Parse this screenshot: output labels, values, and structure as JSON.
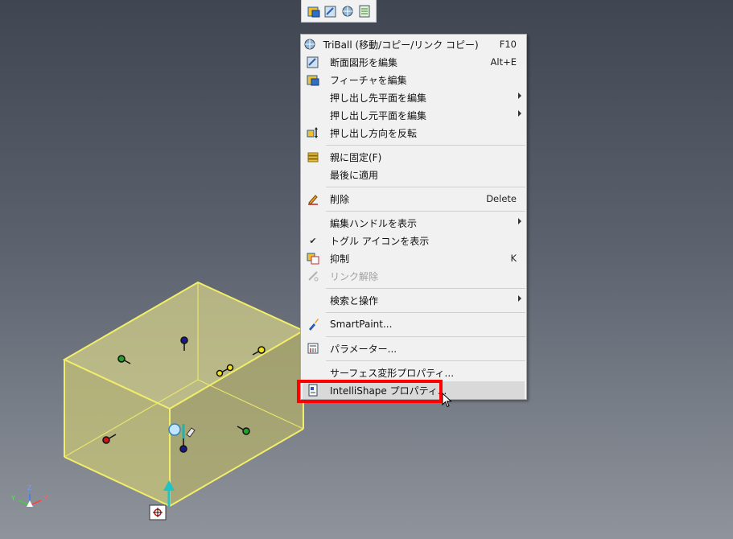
{
  "toolbar": {
    "icons": [
      "edit-feature-icon",
      "edit-section-icon",
      "triball-icon",
      "parameters-icon"
    ]
  },
  "menu": {
    "items": [
      {
        "label": "TriBall (移動/コピー/リンク コピー)",
        "shortcut": "F10",
        "icon": "triball-icon"
      },
      {
        "label": "断面図形を編集",
        "shortcut": "Alt+E",
        "icon": "edit-section-icon"
      },
      {
        "label": "フィーチャを編集",
        "shortcut": "",
        "icon": "edit-feature-icon"
      },
      {
        "label": "押し出し先平面を編集",
        "shortcut": "",
        "submenu": true
      },
      {
        "label": "押し出し元平面を編集",
        "shortcut": "",
        "submenu": true
      },
      {
        "label": "押し出し方向を反転",
        "shortcut": "",
        "icon": "flip-direction-icon"
      },
      {
        "label": "親に固定(F)",
        "shortcut": "",
        "icon": "anchor-to-parent-icon"
      },
      {
        "label": "最後に適用",
        "shortcut": ""
      },
      {
        "label": "削除",
        "shortcut": "Delete",
        "icon": "delete-icon"
      },
      {
        "label": "編集ハンドルを表示",
        "shortcut": "",
        "submenu": true
      },
      {
        "label": "トグル アイコンを表示",
        "shortcut": "",
        "icon": "checkmark-icon"
      },
      {
        "label": "抑制",
        "shortcut": "K",
        "icon": "suppress-icon"
      },
      {
        "label": "リンク解除",
        "shortcut": "",
        "icon": "unlink-icon",
        "disabled": true
      },
      {
        "label": "検索と操作",
        "shortcut": "",
        "submenu": true
      },
      {
        "label": "SmartPaint...",
        "shortcut": "",
        "icon": "smartpaint-icon"
      },
      {
        "label": "パラメーター...",
        "shortcut": "",
        "icon": "parameters-icon"
      },
      {
        "label": "サーフェス変形プロパティ...",
        "shortcut": ""
      },
      {
        "label": "IntelliShape プロパティ...",
        "shortcut": "",
        "icon": "intellishape-properties-icon"
      }
    ]
  },
  "axis": {
    "x": "X",
    "y": "Y",
    "z": "Z"
  },
  "colors": {
    "menu_bg": "#f1f1f1",
    "highlight": "#ff0000",
    "box_edge": "#f2ee6a",
    "box_fill": "#d8d48a"
  }
}
